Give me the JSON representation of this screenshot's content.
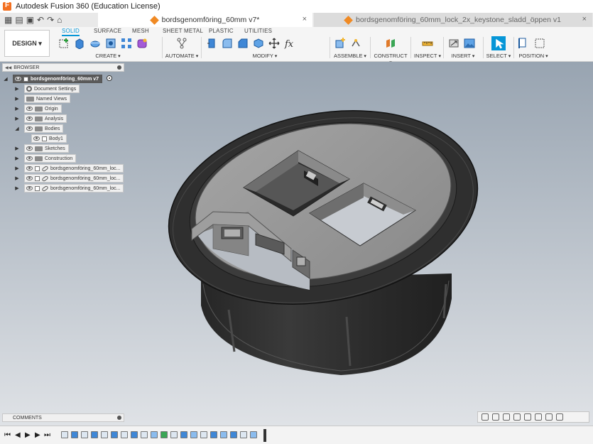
{
  "window": {
    "title": "Autodesk Fusion 360 (Education License)"
  },
  "tabs": [
    {
      "label": "bordsgenomföring_60mm v7*",
      "active": true
    },
    {
      "label": "bordsgenomföring_60mm_lock_2x_keystone_sladd_öppen v1",
      "active": false
    }
  ],
  "workspace": {
    "label": "DESIGN"
  },
  "toolbar": {
    "tabs": [
      "SOLID",
      "SURFACE",
      "MESH",
      "SHEET METAL",
      "PLASTIC",
      "UTILITIES"
    ],
    "groups": [
      "CREATE",
      "AUTOMATE",
      "MODIFY",
      "ASSEMBLE",
      "CONSTRUCT",
      "INSPECT",
      "INSERT",
      "SELECT",
      "POSITION"
    ]
  },
  "browser": {
    "title": "BROWSER",
    "items": [
      {
        "label": "bordsgenomföring_60mm v7"
      },
      {
        "label": "Document Settings"
      },
      {
        "label": "Named Views"
      },
      {
        "label": "Origin"
      },
      {
        "label": "Analysis"
      },
      {
        "label": "Bodies"
      },
      {
        "label": "Body1"
      },
      {
        "label": "Sketches"
      },
      {
        "label": "Construction"
      },
      {
        "label": "bordsgenomföring_60mm_loc..."
      },
      {
        "label": "bordsgenomföring_60mm_loc..."
      },
      {
        "label": "bordsgenomföring_60mm_loc..."
      }
    ]
  },
  "comments": {
    "title": "COMMENTS"
  },
  "colors": {
    "accent": "#0696d7",
    "model_dark": "#2b2b2b",
    "model_light": "#9a9a9a"
  }
}
